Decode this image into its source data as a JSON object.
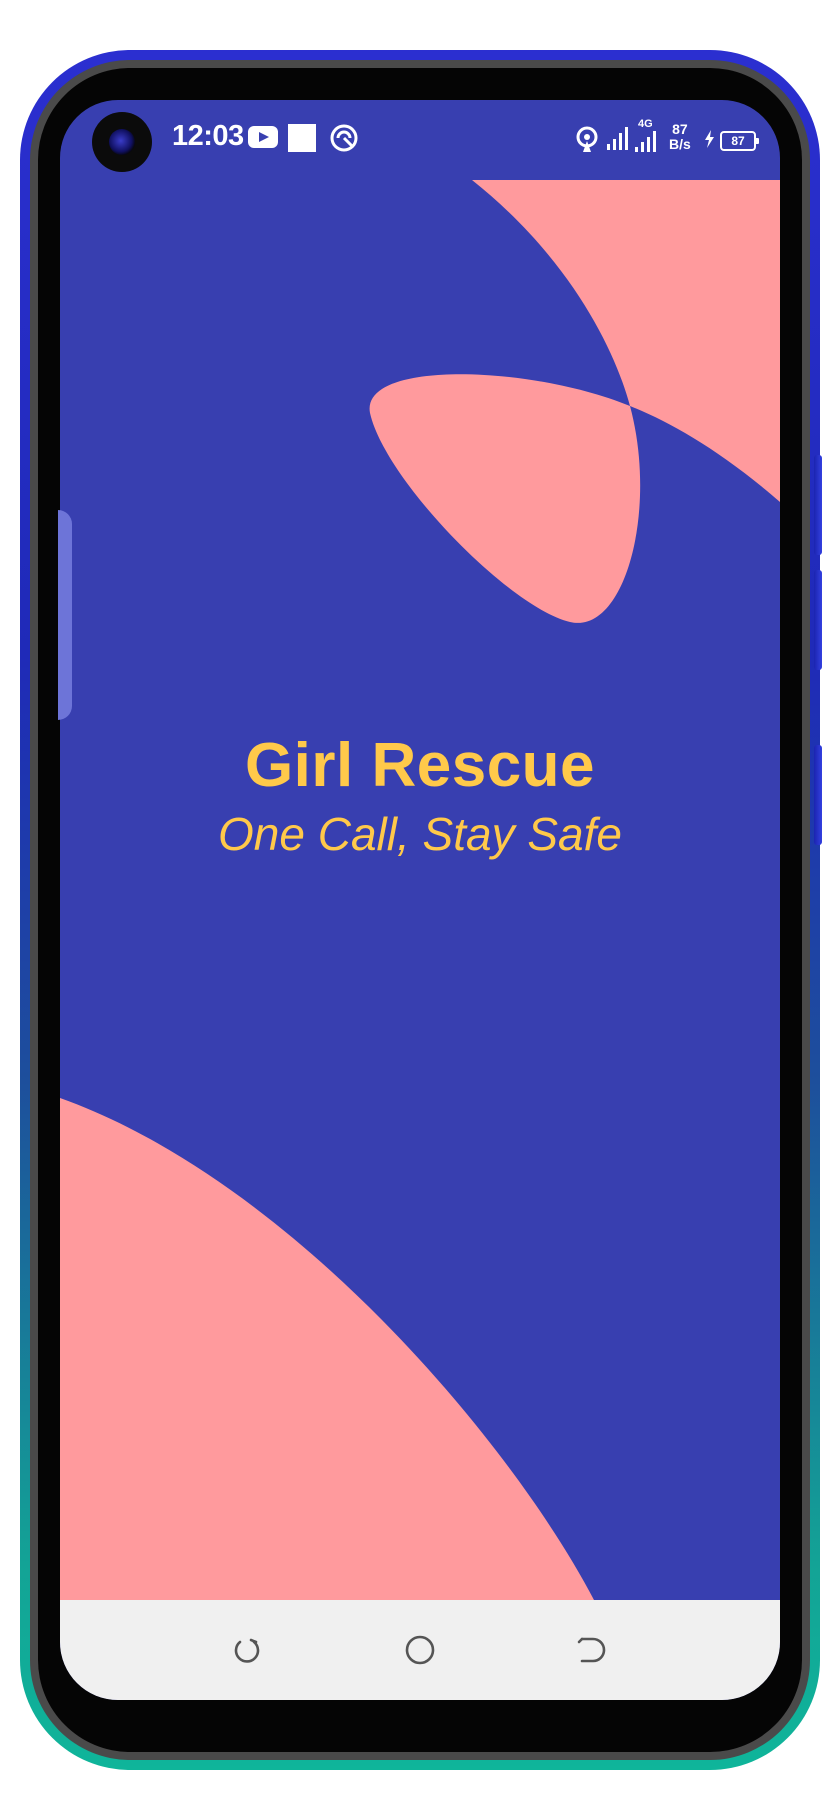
{
  "status_bar": {
    "time": "12:03",
    "network_type": "4G",
    "speed_value": "87",
    "speed_unit": "B/s",
    "battery_level": "87",
    "icons": [
      "camera-punch-hole",
      "youtube-icon",
      "white-square-icon",
      "vpn-icon",
      "hotspot-icon",
      "signal-bars-icon",
      "signal-bars-4g-icon",
      "charging-icon",
      "battery-icon"
    ]
  },
  "app": {
    "title": "Girl Rescue",
    "tagline": "One Call, Stay Safe"
  },
  "nav_bar": {
    "icons": [
      "recent-apps-icon",
      "home-icon",
      "back-icon"
    ]
  },
  "colors": {
    "background": "#383fb0",
    "shape_pink": "#ff9a9d",
    "title_yellow": "#ffc94a",
    "navbar": "#f0f0f0"
  }
}
